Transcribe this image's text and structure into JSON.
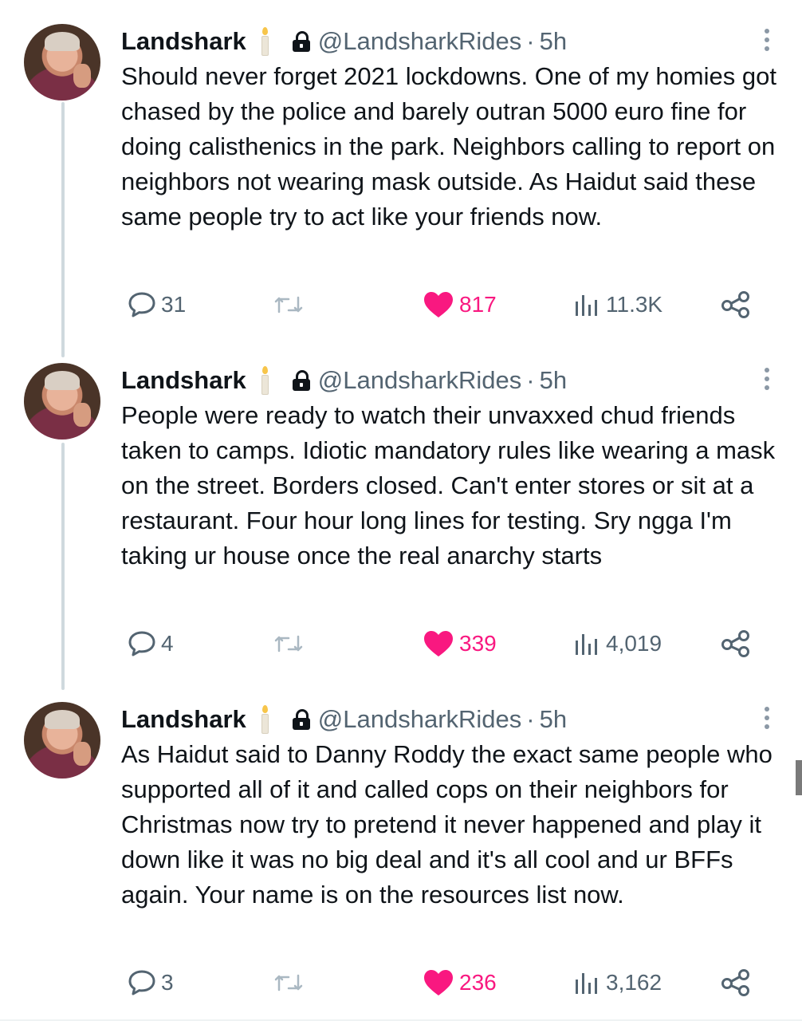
{
  "tweets": [
    {
      "name": "Landshark",
      "handle": "@LandsharkRides",
      "separator": "·",
      "time": "5h",
      "text": "Should never forget 2021 lockdowns. One of my homies got chased by the police and barely outran 5000 euro fine for doing calisthenics in the park. Neighbors calling to report on neighbors not wearing mask outside. As Haidut said these same people try to act like your friends now.",
      "replies": "31",
      "likes": "817",
      "views": "11.3K"
    },
    {
      "name": "Landshark",
      "handle": "@LandsharkRides",
      "separator": "·",
      "time": "5h",
      "text": "People were ready to watch their unvaxxed chud friends taken to camps. Idiotic mandatory rules like wearing a mask on the street. Borders closed. Can't enter stores or sit at a restaurant. Four hour long lines for testing. Sry ngga I'm taking ur house once the real anarchy starts",
      "replies": "4",
      "likes": "339",
      "views": "4,019"
    },
    {
      "name": "Landshark",
      "handle": "@LandsharkRides",
      "separator": "·",
      "time": "5h",
      "text": "As Haidut said to Danny Roddy the exact same people who supported all of it and called cops on their neighbors for Christmas  now try to pretend it never happened and play it down like it was no big deal and it's all cool and ur BFFs again. Your name is on the resources list now.",
      "replies": "3",
      "likes": "236",
      "views": "3,162"
    }
  ],
  "icons": {
    "avatar": "profile-photo",
    "badge": "candle-icon",
    "lock": "lock-icon",
    "more": "more-vertical-icon",
    "reply": "reply-bubble-icon",
    "retweet": "retweet-icon",
    "like": "heart-icon",
    "views": "views-bar-icon",
    "share": "share-icon"
  },
  "colors": {
    "like": "#f91880",
    "secondary_text": "#536471",
    "thread_line": "#cfd9de"
  }
}
